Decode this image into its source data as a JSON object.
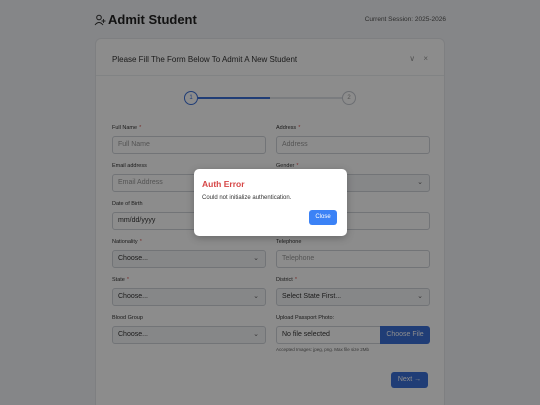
{
  "header": {
    "title": "Admit Student",
    "session": "Current Session: 2025-2026",
    "icon": "user-plus-icon"
  },
  "form": {
    "heading": "Please Fill The Form Below To Admit A New Student",
    "actions": {
      "collapse": "∨",
      "close": "×"
    },
    "steps": [
      "1",
      "2"
    ],
    "current_step": 1,
    "fields": {
      "full_name": {
        "label": "Full Name",
        "required": "*",
        "placeholder": "Full Name"
      },
      "address": {
        "label": "Address",
        "required": "*",
        "placeholder": "Address"
      },
      "email": {
        "label": "Email address",
        "placeholder": "Email Address"
      },
      "gender": {
        "label": "Gender",
        "required": "*"
      },
      "dob": {
        "label": "Date of Birth",
        "value": "mm/dd/yyyy"
      },
      "nationality": {
        "label": "Nationality",
        "required": "*",
        "value": "Choose..."
      },
      "telephone": {
        "label": "Telephone",
        "placeholder": "Telephone"
      },
      "state": {
        "label": "State",
        "required": "*",
        "value": "Choose..."
      },
      "district": {
        "label": "District",
        "required": "*",
        "value": "Select State First..."
      },
      "blood_group": {
        "label": "Blood Group",
        "value": "Choose..."
      },
      "passport": {
        "label": "Upload Passport Photo:",
        "file_value": "No file selected",
        "button": "Choose File",
        "hint": "Accepted Images: jpeg, png. Max file size 2Mb"
      }
    },
    "next_button": "Next →"
  },
  "modal": {
    "title": "Auth Error",
    "message": "Could not initialize authentication.",
    "close_button": "Close",
    "title_color": "#d64545"
  },
  "colors": {
    "accent": "#3b6fd8"
  }
}
